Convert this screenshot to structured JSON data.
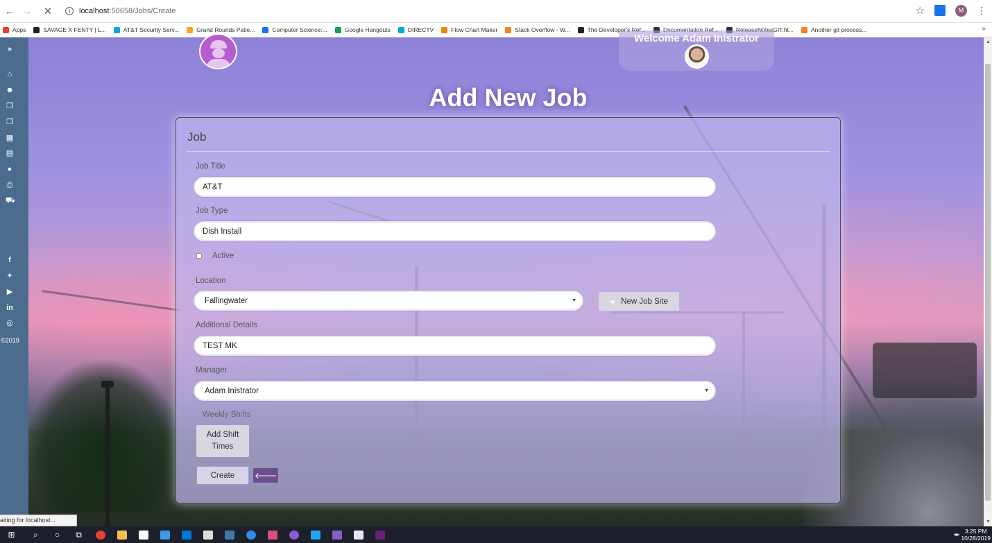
{
  "browser": {
    "url_host": "localhost",
    "url_path": ":50658/Jobs/Create",
    "profile_initial": "M",
    "bookmarks": [
      {
        "label": "Apps",
        "color": "#e94235"
      },
      {
        "label": "SAVAGE X FENTY | L...",
        "color": "#222222"
      },
      {
        "label": "AT&T Security Serv...",
        "color": "#00a8e0"
      },
      {
        "label": "Grand Rounds Patie...",
        "color": "#f5a623"
      },
      {
        "label": "Computer Science:...",
        "color": "#1a73e8"
      },
      {
        "label": "Google Hangouts",
        "color": "#0f9d58"
      },
      {
        "label": "DIRECTV",
        "color": "#00a8e0"
      },
      {
        "label": "Flow Chart Maker",
        "color": "#f08705"
      },
      {
        "label": "Stack Overflow - W...",
        "color": "#f48024"
      },
      {
        "label": "The Developer's Ref...",
        "color": "#222222"
      },
      {
        "label": "Documentation Ref...",
        "color": "#333333"
      },
      {
        "label": "ReleaseNotesGIT.ht...",
        "color": "#333333"
      },
      {
        "label": "Another git process...",
        "color": "#f48024"
      }
    ],
    "status_text": "aiting for localhost..."
  },
  "header": {
    "welcome": "Welcome Adam Inistrator",
    "page_title": "Add New Job"
  },
  "sidebar": {
    "copyright": "©2019"
  },
  "form": {
    "card_title": "Job",
    "job_title_label": "Job Title",
    "job_title_value": "AT&T",
    "job_type_label": "Job Type",
    "job_type_value": "Dish Install",
    "active_label": "Active",
    "location_label": "Location",
    "location_value": "Fallingwater",
    "new_job_site_label": "New Job Site",
    "details_label": "Additional Details",
    "details_value": "TEST MK",
    "manager_label": "Manager",
    "manager_value": "Adam Inistrator",
    "weekly_shifts_label": "Weekly Shifts",
    "add_shift_line1": "Add Shift",
    "add_shift_line2": "Times",
    "create_label": "Create"
  },
  "taskbar": {
    "time": "3:25 PM",
    "date": "10/28/2019"
  },
  "colors": {
    "sidebar": "#4c6c8e",
    "back_button": "#6c4e8e",
    "logo": "#b65ccf"
  }
}
